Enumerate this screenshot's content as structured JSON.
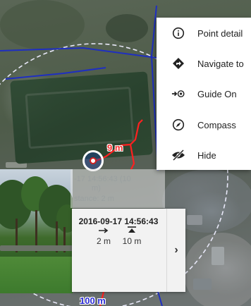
{
  "menu": {
    "items": [
      {
        "label": "Point detail",
        "icon": "info-icon"
      },
      {
        "label": "Navigate to",
        "icon": "navigate-icon"
      },
      {
        "label": "Guide On",
        "icon": "guide-icon"
      },
      {
        "label": "Compass",
        "icon": "compass-icon"
      },
      {
        "label": "Hide",
        "icon": "hide-icon"
      }
    ]
  },
  "map": {
    "distance_label": "9 m",
    "scale_label": "100 m",
    "track_color": "#ff2020",
    "line_color": "#1f2fc0"
  },
  "ghost_card": {
    "line1": "-17 14:56:43 (10",
    "line2": "m)",
    "line3": "stance: 2 m"
  },
  "point_card": {
    "timestamp": "2016-09-17 14:56:43",
    "distance": "2 m",
    "elevation": "10 m",
    "next": "›"
  }
}
